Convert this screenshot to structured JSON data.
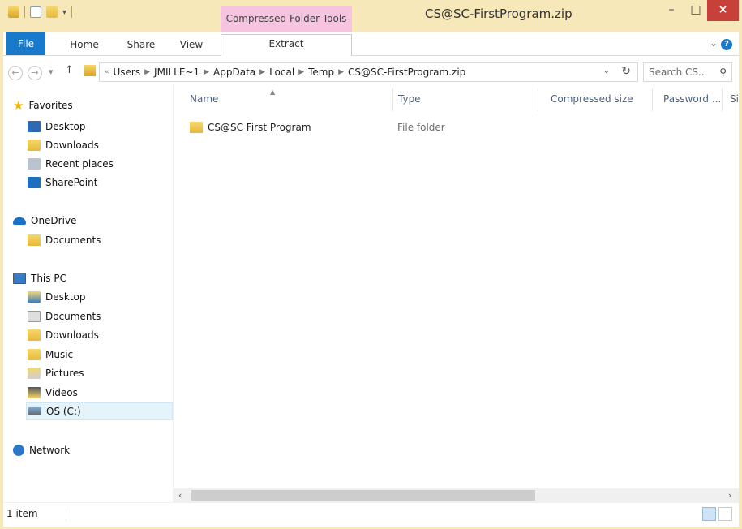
{
  "window": {
    "title": "CS@SC-FirstProgram.zip",
    "context_tab": "Compressed Folder Tools",
    "controls": {
      "minimize": "–",
      "maximize": "□",
      "close": "×"
    }
  },
  "ribbon": {
    "tabs": [
      {
        "label": "File"
      },
      {
        "label": "Home"
      },
      {
        "label": "Share"
      },
      {
        "label": "View"
      },
      {
        "label": "Extract"
      }
    ]
  },
  "address": {
    "overflow": "«",
    "crumbs": [
      "Users",
      "JMILLE~1",
      "AppData",
      "Local",
      "Temp",
      "CS@SC-FirstProgram.zip"
    ]
  },
  "search": {
    "placeholder": "Search CS..."
  },
  "nav_pane": {
    "groups": [
      {
        "label": "Favorites",
        "icon": "star-icon",
        "items": [
          {
            "label": "Desktop",
            "icon": "desktop-icon"
          },
          {
            "label": "Downloads",
            "icon": "downloads-icon"
          },
          {
            "label": "Recent places",
            "icon": "recent-places-icon"
          },
          {
            "label": "SharePoint",
            "icon": "sharepoint-icon"
          }
        ]
      },
      {
        "label": "OneDrive",
        "icon": "onedrive-icon",
        "items": [
          {
            "label": "Documents",
            "icon": "folder-icon"
          }
        ]
      },
      {
        "label": "This PC",
        "icon": "computer-icon",
        "items": [
          {
            "label": "Desktop",
            "icon": "desktop-folder-icon"
          },
          {
            "label": "Documents",
            "icon": "documents-icon"
          },
          {
            "label": "Downloads",
            "icon": "downloads-icon"
          },
          {
            "label": "Music",
            "icon": "music-icon"
          },
          {
            "label": "Pictures",
            "icon": "pictures-icon"
          },
          {
            "label": "Videos",
            "icon": "videos-icon"
          },
          {
            "label": "OS (C:)",
            "icon": "drive-icon"
          }
        ]
      },
      {
        "label": "Network",
        "icon": "network-icon",
        "items": []
      }
    ]
  },
  "columns": [
    "Name",
    "Type",
    "Compressed size",
    "Password ...",
    "Siz"
  ],
  "rows": [
    {
      "name": "CS@SC First Program",
      "type": "File folder"
    }
  ],
  "status": {
    "count": "1 item"
  },
  "colors": {
    "accent": "#1979ca",
    "title_bar": "#f6e8b9",
    "context_tab": "#f6c4df",
    "close": "#c7403a"
  }
}
